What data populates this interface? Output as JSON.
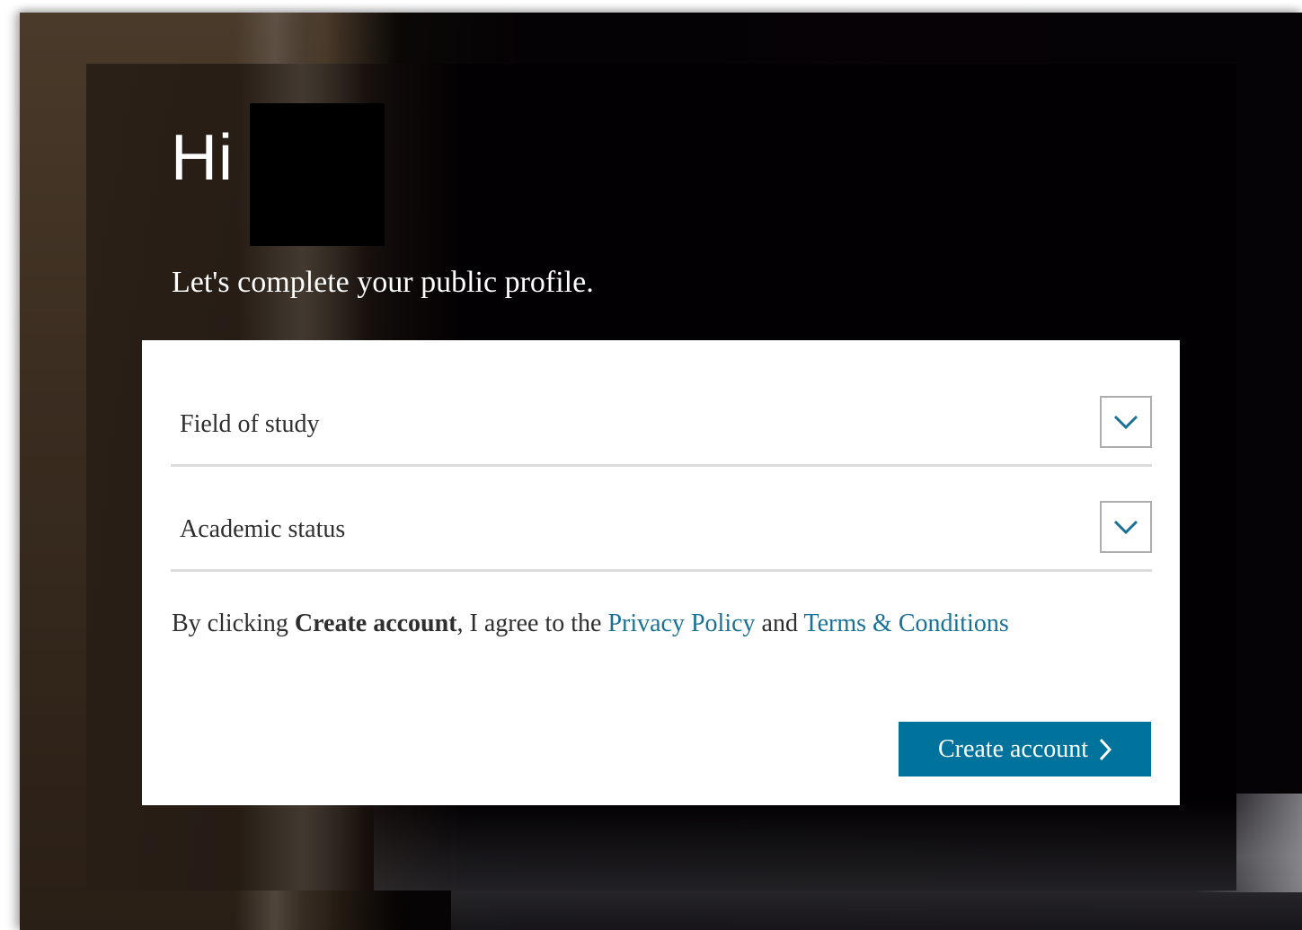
{
  "greeting": "Hi",
  "subtitle": "Let's complete your public profile.",
  "form": {
    "field_of_study_label": "Field of study",
    "academic_status_label": "Academic status",
    "consent": {
      "prefix": "By clicking ",
      "bold": "Create account",
      "middle": ", I agree to the ",
      "privacy_link": "Privacy Policy",
      "and": " and ",
      "terms_link": "Terms & Conditions"
    },
    "create_button_label": "Create account"
  },
  "icons": {
    "dropdown": "chevron-down-icon",
    "button_arrow": "chevron-right-icon"
  },
  "colors": {
    "accent": "#00739c",
    "link": "#1a7196",
    "chevron": "#1a7196"
  }
}
